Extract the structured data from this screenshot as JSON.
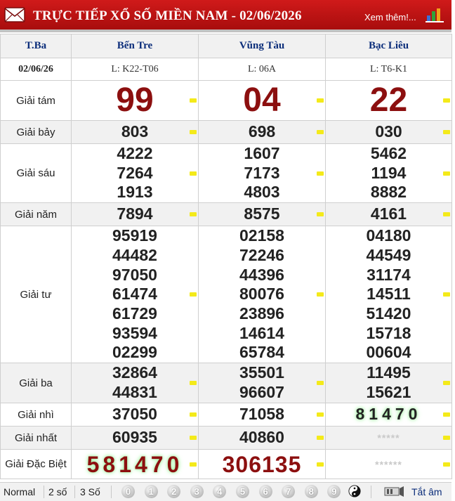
{
  "header": {
    "title": "TRỰC TIẾP XỔ SỐ MIỀN NAM - 02/06/2026",
    "more_link": "Xem thêm!...",
    "icons": [
      "mail-icon",
      "bar-chart-icon"
    ]
  },
  "table": {
    "day": "T.Ba",
    "date": "02/06/26",
    "provinces": [
      {
        "name": "Bến Tre",
        "code": "L: K22-T06"
      },
      {
        "name": "Vũng Tàu",
        "code": "L: 06A"
      },
      {
        "name": "Bạc Liêu",
        "code": "L: T6-K1"
      }
    ],
    "prizes": {
      "g8": {
        "label": "Giải tám",
        "values": [
          [
            "99"
          ],
          [
            "04"
          ],
          [
            "22"
          ]
        ]
      },
      "g7": {
        "label": "Giải bảy",
        "values": [
          [
            "803"
          ],
          [
            "698"
          ],
          [
            "030"
          ]
        ]
      },
      "g6": {
        "label": "Giải sáu",
        "values": [
          [
            "4222",
            "7264",
            "1913"
          ],
          [
            "1607",
            "7173",
            "4803"
          ],
          [
            "5462",
            "1194",
            "8882"
          ]
        ]
      },
      "g5": {
        "label": "Giải năm",
        "values": [
          [
            "7894"
          ],
          [
            "8575"
          ],
          [
            "4161"
          ]
        ]
      },
      "g4": {
        "label": "Giải tư",
        "values": [
          [
            "95919",
            "44482",
            "97050",
            "61474",
            "61729",
            "93594",
            "02299"
          ],
          [
            "02158",
            "72246",
            "44396",
            "80076",
            "23896",
            "14614",
            "65784"
          ],
          [
            "04180",
            "44549",
            "31174",
            "14511",
            "51420",
            "15718",
            "00604"
          ]
        ]
      },
      "g3": {
        "label": "Giải ba",
        "values": [
          [
            "32864",
            "44831"
          ],
          [
            "35501",
            "96607"
          ],
          [
            "11495",
            "15621"
          ]
        ]
      },
      "g2": {
        "label": "Giải nhì",
        "values": [
          [
            "37050"
          ],
          [
            "71058"
          ],
          [
            "81470"
          ]
        ]
      },
      "g1": {
        "label": "Giải nhất",
        "values": [
          [
            "60935"
          ],
          [
            "40860"
          ],
          [
            "*****"
          ]
        ]
      },
      "db": {
        "label": "Giải Đặc Biệt",
        "values": [
          [
            "581470"
          ],
          [
            "306135"
          ],
          [
            "******"
          ]
        ]
      }
    }
  },
  "toolbar": {
    "modes": [
      "Normal",
      "2 số",
      "3 Số"
    ],
    "digits": [
      "0",
      "1",
      "2",
      "3",
      "4",
      "5",
      "6",
      "7",
      "8",
      "9"
    ],
    "auto_label": "Tắt âm",
    "icons": [
      "yin-yang-icon",
      "speaker-icon"
    ]
  },
  "colors": {
    "header_red": "#c41414",
    "prize_red": "#8c0f0f",
    "province_blue": "#0b2d7a",
    "marker_yellow": "#f4ea1a",
    "highlight_green": "#9cf09c"
  }
}
